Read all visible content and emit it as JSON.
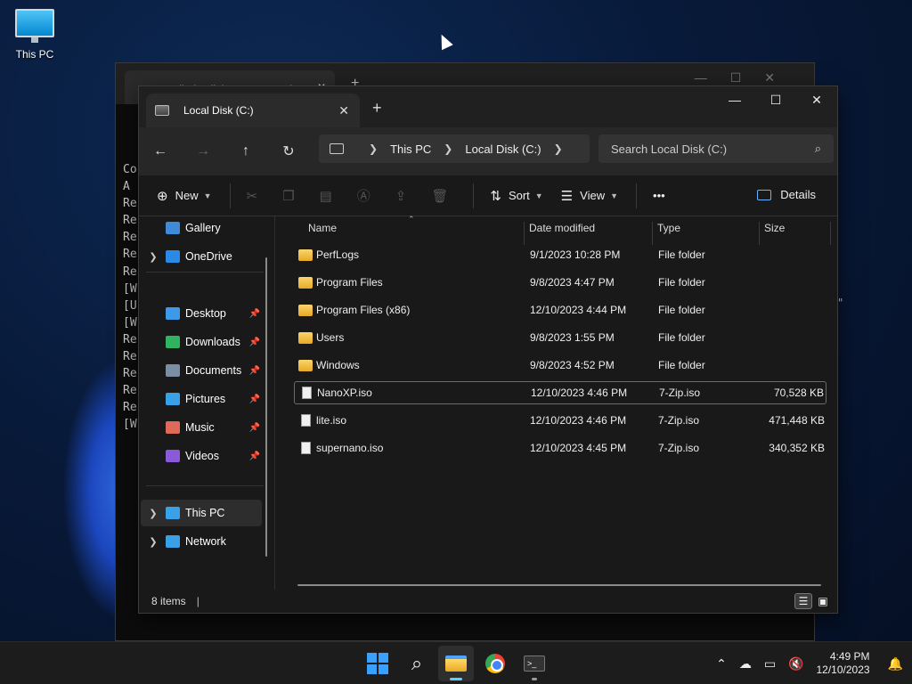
{
  "desktop": {
    "icon_label": "This PC"
  },
  "bg_window": {
    "tab_title": "compiled-collab-vm-server-wi",
    "terminal_lines": [
      "Co",
      "A",
      "Re",
      "Re",
      "Re",
      "Re",
      "Re",
      "[W",
      "[U",
      "[W",
      "Re",
      "Re",
      "Re",
      "Re",
      "Re",
      "[W"
    ],
    "stray_text": "\""
  },
  "explorer": {
    "tab_title": "Local Disk (C:)",
    "tab_close": "✕",
    "new_tab": "+",
    "win_controls": {
      "minimize": "—",
      "maximize": "☐",
      "close": "✕"
    },
    "nav": {
      "back": "←",
      "forward": "→",
      "up": "↑",
      "refresh": "↻"
    },
    "breadcrumb": [
      "This PC",
      "Local Disk (C:)"
    ],
    "search_placeholder": "Search Local Disk (C:)",
    "commands": {
      "new": "New",
      "sort": "Sort",
      "view": "View",
      "more": "•••",
      "details": "Details"
    },
    "nav_pane": [
      {
        "label": "Gallery",
        "icon": "gallery-icon",
        "color": "#3f8bd8",
        "expandable": false,
        "pinned": false
      },
      {
        "label": "OneDrive",
        "icon": "cloud-icon",
        "color": "#2b8ae6",
        "expandable": true,
        "pinned": false
      },
      {
        "label": "Desktop",
        "icon": "desktop-folder-icon",
        "color": "#3e9ae8",
        "expandable": false,
        "pinned": true
      },
      {
        "label": "Downloads",
        "icon": "download-icon",
        "color": "#2fb35f",
        "expandable": false,
        "pinned": true
      },
      {
        "label": "Documents",
        "icon": "document-icon",
        "color": "#7c8ea3",
        "expandable": false,
        "pinned": true
      },
      {
        "label": "Pictures",
        "icon": "pictures-icon",
        "color": "#3aa0e8",
        "expandable": false,
        "pinned": true
      },
      {
        "label": "Music",
        "icon": "music-icon",
        "color": "#e06a5a",
        "expandable": false,
        "pinned": true
      },
      {
        "label": "Videos",
        "icon": "videos-icon",
        "color": "#8a5ad8",
        "expandable": false,
        "pinned": true
      },
      {
        "label": "This PC",
        "icon": "computer-icon",
        "color": "#3aa0e8",
        "expandable": true,
        "pinned": false,
        "selected": true
      },
      {
        "label": "Network",
        "icon": "network-icon",
        "color": "#3aa0e8",
        "expandable": true,
        "pinned": false
      }
    ],
    "columns": [
      "Name",
      "Date modified",
      "Type",
      "Size"
    ],
    "files": [
      {
        "name": "PerfLogs",
        "date": "9/1/2023 10:28 PM",
        "type": "File folder",
        "size": "",
        "kind": "folder"
      },
      {
        "name": "Program Files",
        "date": "9/8/2023 4:47 PM",
        "type": "File folder",
        "size": "",
        "kind": "folder"
      },
      {
        "name": "Program Files (x86)",
        "date": "12/10/2023 4:44 PM",
        "type": "File folder",
        "size": "",
        "kind": "folder"
      },
      {
        "name": "Users",
        "date": "9/8/2023 1:55 PM",
        "type": "File folder",
        "size": "",
        "kind": "folder"
      },
      {
        "name": "Windows",
        "date": "9/8/2023 4:52 PM",
        "type": "File folder",
        "size": "",
        "kind": "folder"
      },
      {
        "name": "NanoXP.iso",
        "date": "12/10/2023 4:46 PM",
        "type": "7-Zip.iso",
        "size": "70,528 KB",
        "kind": "file",
        "focused": true
      },
      {
        "name": "lite.iso",
        "date": "12/10/2023 4:46 PM",
        "type": "7-Zip.iso",
        "size": "471,448 KB",
        "kind": "file"
      },
      {
        "name": "supernano.iso",
        "date": "12/10/2023 4:45 PM",
        "type": "7-Zip.iso",
        "size": "340,352 KB",
        "kind": "file"
      }
    ],
    "status": {
      "item_count": "8 items"
    }
  },
  "taskbar": {
    "apps": [
      "start-button",
      "search-button",
      "file-explorer-button",
      "chrome-button",
      "terminal-button"
    ],
    "tray": {
      "time": "4:49 PM",
      "date": "12/10/2023"
    }
  }
}
